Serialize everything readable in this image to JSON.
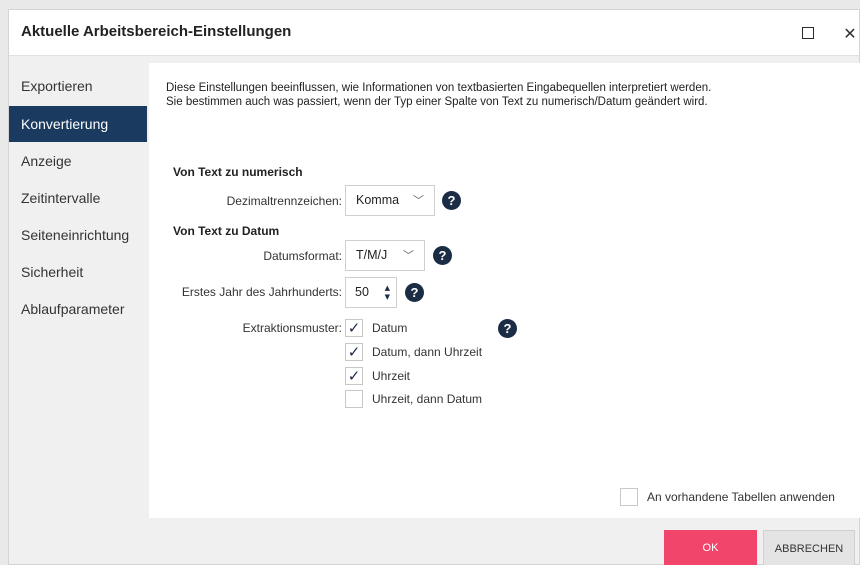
{
  "window": {
    "title": "Aktuelle Arbeitsbereich-Einstellungen",
    "maximize_icon": "□",
    "close_icon": "✕"
  },
  "nav": {
    "items": [
      "Exportieren",
      "Konvertierung",
      "Anzeige",
      "Zeitintervalle",
      "Seiteneinrichtung",
      "Sicherheit",
      "Ablaufparameter"
    ],
    "active": "Konvertierung"
  },
  "intro": "Diese Einstellungen beeinflussen, wie Informationen von textbasierten Eingabequellen interpretiert werden.  Sie bestimmen auch was passiert, wenn der Typ einer Spalte von Text zu numerisch/Datum geändert wird.",
  "numeric": {
    "heading": "Von Text zu numerisch",
    "decimal_label": "Dezimaltrennzeichen:",
    "decimal_value": "Komma"
  },
  "date": {
    "heading": "Von Text zu Datum",
    "format_label": "Datumsformat:",
    "format_value": "T/M/J"
  },
  "century": {
    "label": "Erstes Jahr des Jahrhunderts:",
    "value": "50"
  },
  "extraction": {
    "label": "Extraktionsmuster:",
    "options": [
      {
        "label": "Datum",
        "checked": true
      },
      {
        "label": "Datum, dann Uhrzeit",
        "checked": true
      },
      {
        "label": "Uhrzeit",
        "checked": true
      },
      {
        "label": "Uhrzeit, dann Datum",
        "checked": false
      }
    ]
  },
  "apply_existing": {
    "label": "An vorhandene Tabellen anwenden",
    "checked": false
  },
  "help_glyph": "?",
  "check_glyph": "✓",
  "chevron_glyph": "﹀",
  "buttons": {
    "ok": "OK",
    "cancel": "ABBRECHEN"
  },
  "colors": {
    "nav_active": "#1a3a5f",
    "ok": "#f1456b",
    "help": "#1b2c45"
  }
}
